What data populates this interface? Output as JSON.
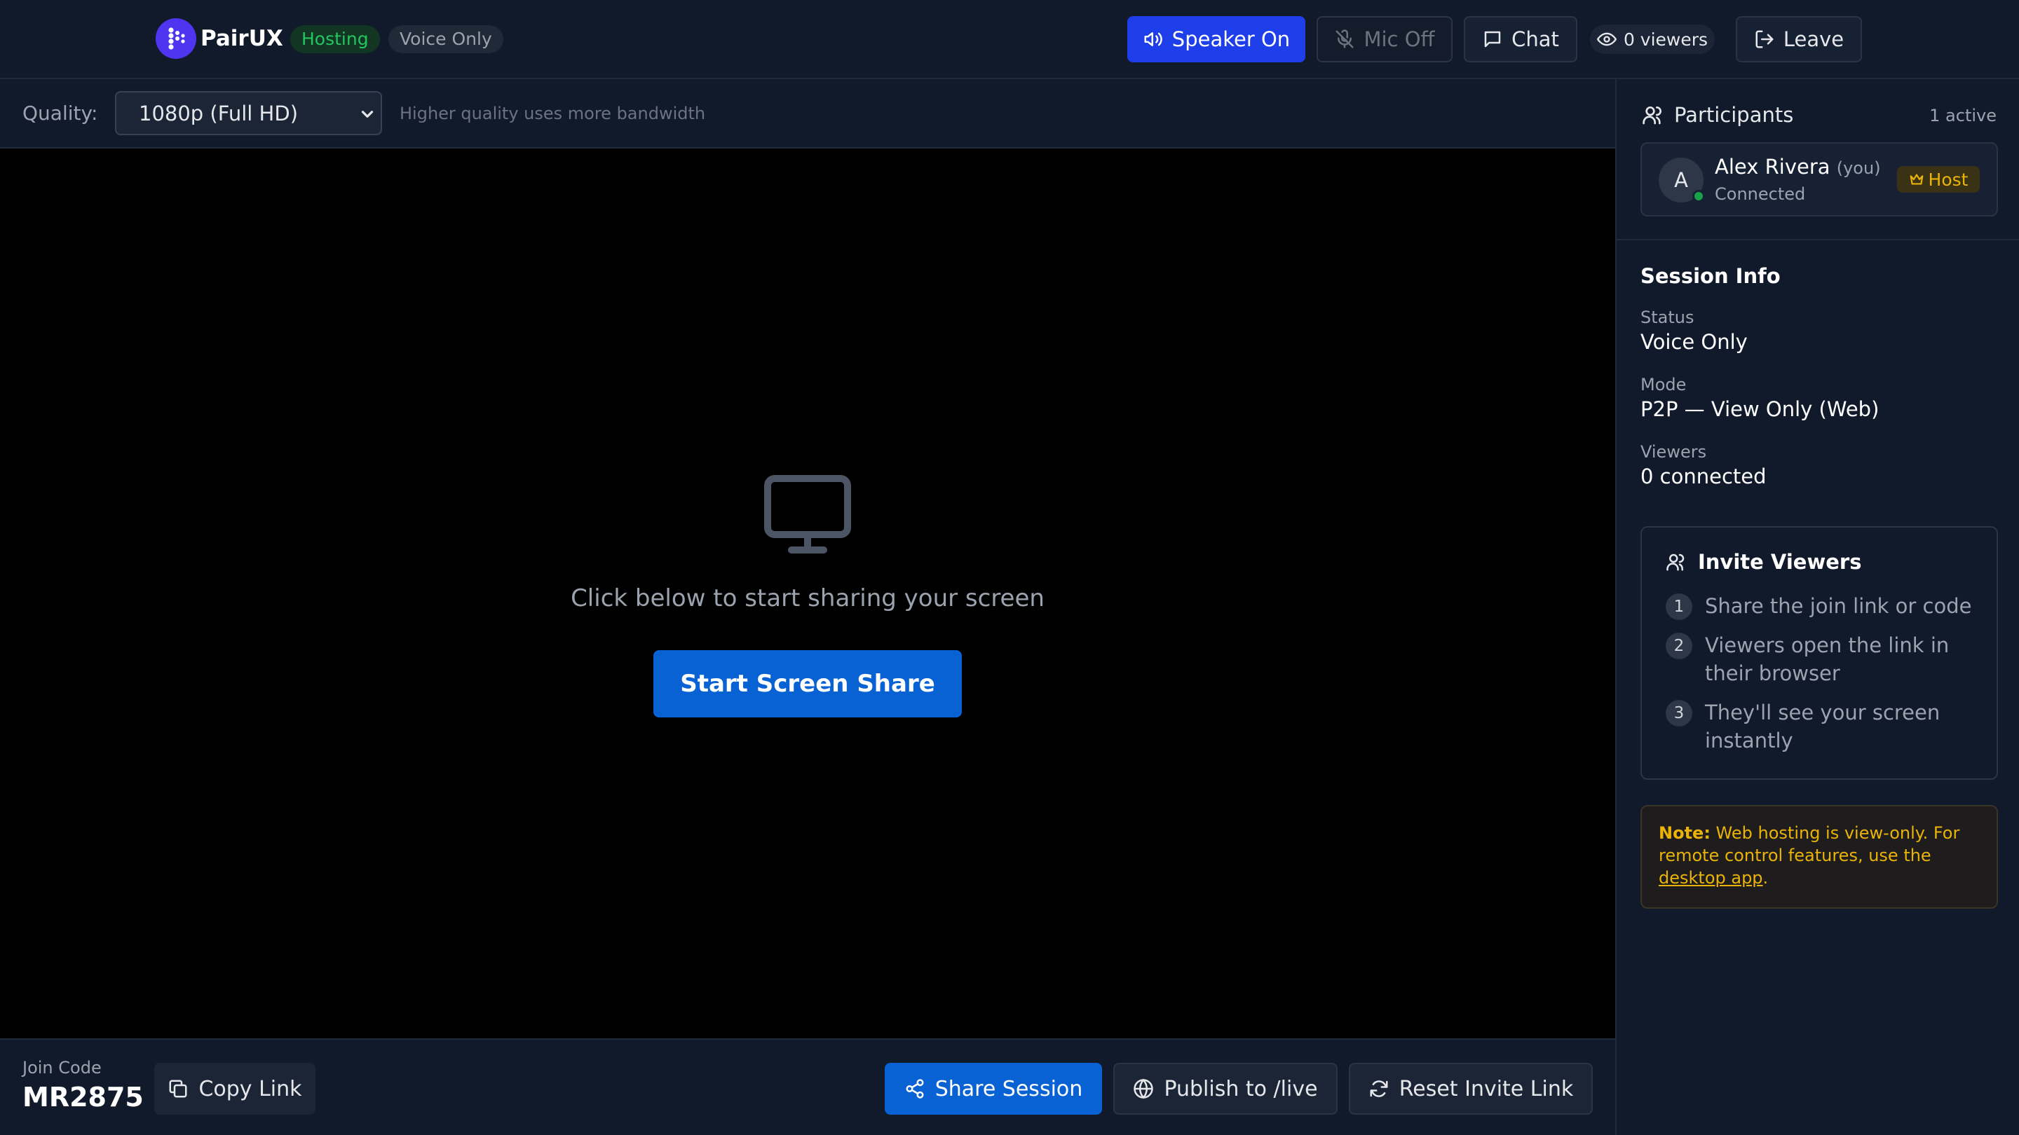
{
  "app": {
    "name": "PairUX"
  },
  "header": {
    "badge_hosting": "Hosting",
    "badge_voice": "Voice Only",
    "speaker_label": "Speaker On",
    "mic_label": "Mic Off",
    "chat_label": "Chat",
    "viewers_label": "0 viewers",
    "leave_label": "Leave"
  },
  "quality": {
    "label": "Quality:",
    "selected": "1080p (Full HD)",
    "hint": "Higher quality uses more bandwidth"
  },
  "stage": {
    "message": "Click below to start sharing your screen",
    "start_button": "Start Screen Share"
  },
  "footer": {
    "join_code_label": "Join Code",
    "join_code": "MR2875",
    "copy_link": "Copy Link",
    "share_session": "Share Session",
    "publish": "Publish to /live",
    "reset_link": "Reset Invite Link"
  },
  "participants": {
    "title": "Participants",
    "active_count": "1 active",
    "list": [
      {
        "initial": "A",
        "name": "Alex Rivera",
        "you": "(you)",
        "status": "Connected",
        "role": "Host"
      }
    ]
  },
  "session_info": {
    "title": "Session Info",
    "status_label": "Status",
    "status_value": "Voice Only",
    "mode_label": "Mode",
    "mode_value": "P2P — View Only (Web)",
    "viewers_label": "Viewers",
    "viewers_value": "0 connected"
  },
  "invite": {
    "title": "Invite Viewers",
    "steps": [
      {
        "num": "1",
        "text": "Share the join link or code"
      },
      {
        "num": "2",
        "text": "Viewers open the link in their browser"
      },
      {
        "num": "3",
        "text": "They'll see your screen instantly"
      }
    ]
  },
  "note": {
    "prefix": "Note:",
    "text": " Web hosting is view-only. For remote control features, use the ",
    "link": "desktop app",
    "suffix": "."
  },
  "colors": {
    "accent_blue": "#1d3ee8",
    "primary_button": "#0962d3",
    "success": "#22c55e",
    "warning": "#eab308",
    "brand": "#4f35f0"
  }
}
